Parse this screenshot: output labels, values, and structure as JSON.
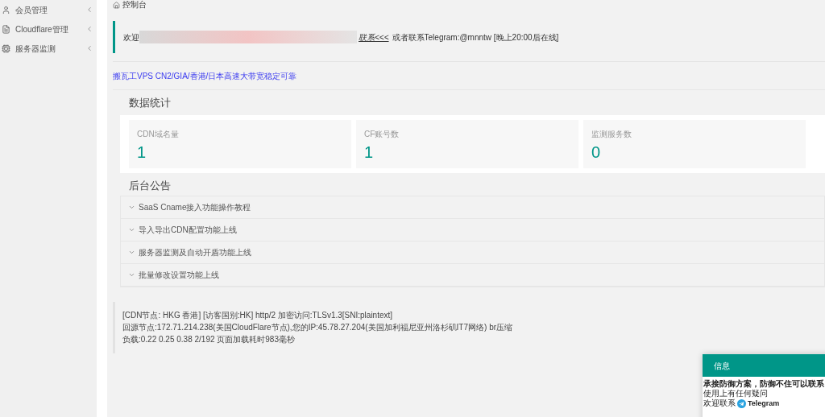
{
  "sidebar": {
    "items": [
      {
        "label": "会员管理",
        "expanded": false
      },
      {
        "label": "Cloudflare管理",
        "expanded": false
      },
      {
        "label": "服务器监测",
        "expanded": false
      }
    ]
  },
  "breadcrumb": "控制台",
  "notice": {
    "prefix": "欢迎",
    "link": "联系<<<",
    "suffix": "或者联系Telegram:@mnntw [晚上20:00后在线]"
  },
  "ad_link": "搬瓦工VPS CN2/GIA/香港/日本高速大带宽稳定可靠",
  "stats": {
    "title": "数据统计",
    "cards": [
      {
        "label": "CDN域名量",
        "value": "1"
      },
      {
        "label": "CF账号数",
        "value": "1"
      },
      {
        "label": "监测服务数",
        "value": "0"
      }
    ]
  },
  "announcements": {
    "title": "后台公告",
    "items": [
      {
        "title": "SaaS Cname接入功能操作教程",
        "expanded": false
      },
      {
        "title": "导入导出CDN配置功能上线",
        "expanded": false
      },
      {
        "title": "服务器监测及自动开盾功能上线",
        "expanded": false
      },
      {
        "title": "批量修改设置功能上线",
        "expanded": false
      }
    ]
  },
  "footer_info": [
    "[CDN节点: HKG 香港] [访客国别:HK] http/2 加密访问:TLSv1.3[SNI:plaintext]",
    "回源节点:172.71.214.238(美国CloudFlare节点),您的IP:45.78.27.204(美国加利福尼亚州洛杉矶IT7网络) br压缩",
    "负载:0.22 0.25 0.38 2/192 页面加载耗时983毫秒"
  ],
  "popup": {
    "title": "信息",
    "headline": "承接防御方案，防御不住可以联系",
    "line_1": "使用上有任何疑问",
    "line_2": "欢迎联系",
    "telegram": "Telegram"
  }
}
